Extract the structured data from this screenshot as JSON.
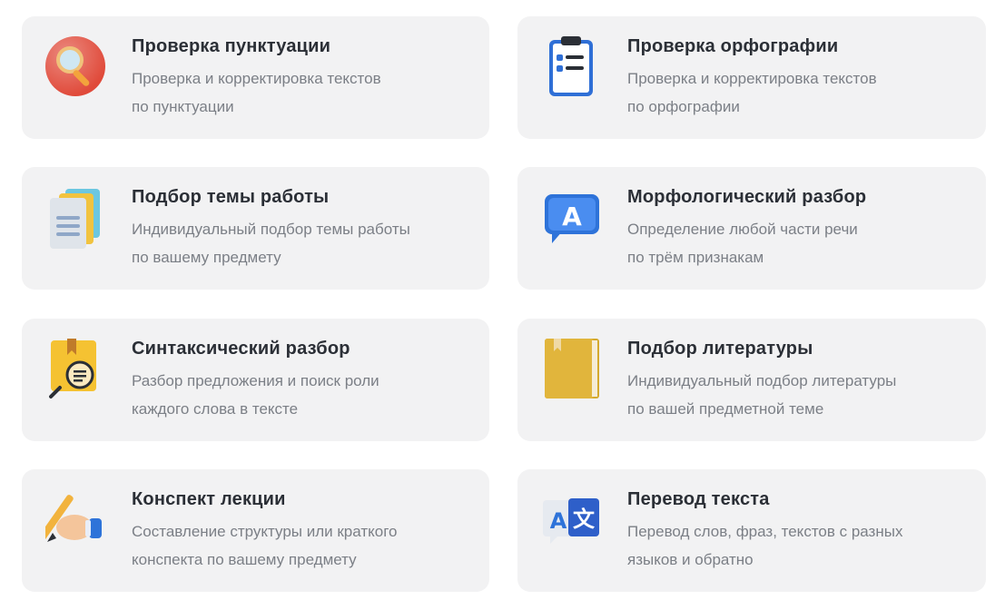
{
  "colors": {
    "card_background": "#f2f2f3",
    "title": "#2b2f36",
    "description": "#7b7f86"
  },
  "services": [
    {
      "icon": "magnifier-icon",
      "title": "Проверка пунктуации",
      "line1": "Проверка и корректировка текстов",
      "line2": "по пунктуации"
    },
    {
      "icon": "clipboard-checklist-icon",
      "title": "Проверка орфографии",
      "line1": "Проверка и корректировка текстов",
      "line2": "по орфографии"
    },
    {
      "icon": "documents-stack-icon",
      "title": "Подбор темы работы",
      "line1": "Индивидуальный подбор темы работы",
      "line2": "по вашему предмету"
    },
    {
      "icon": "letter-a-speech-bubble-icon",
      "title": "Морфологический разбор",
      "line1": "Определение любой части речи",
      "line2": "по трём признакам"
    },
    {
      "icon": "folder-search-icon",
      "title": "Синтаксический разбор",
      "line1": "Разбор предложения и поиск роли",
      "line2": "каждого слова в тексте"
    },
    {
      "icon": "book-icon",
      "title": "Подбор литературы",
      "line1": "Индивидуальный подбор литературы",
      "line2": "по вашей предметной теме"
    },
    {
      "icon": "hand-pencil-icon",
      "title": "Конспект лекции",
      "line1": "Составление структуры или краткого",
      "line2": "конспекта по вашему предмету"
    },
    {
      "icon": "translate-icon",
      "title": "Перевод текста",
      "line1": "Перевод слов, фраз, текстов с разных",
      "line2": "языков и обратно"
    }
  ]
}
